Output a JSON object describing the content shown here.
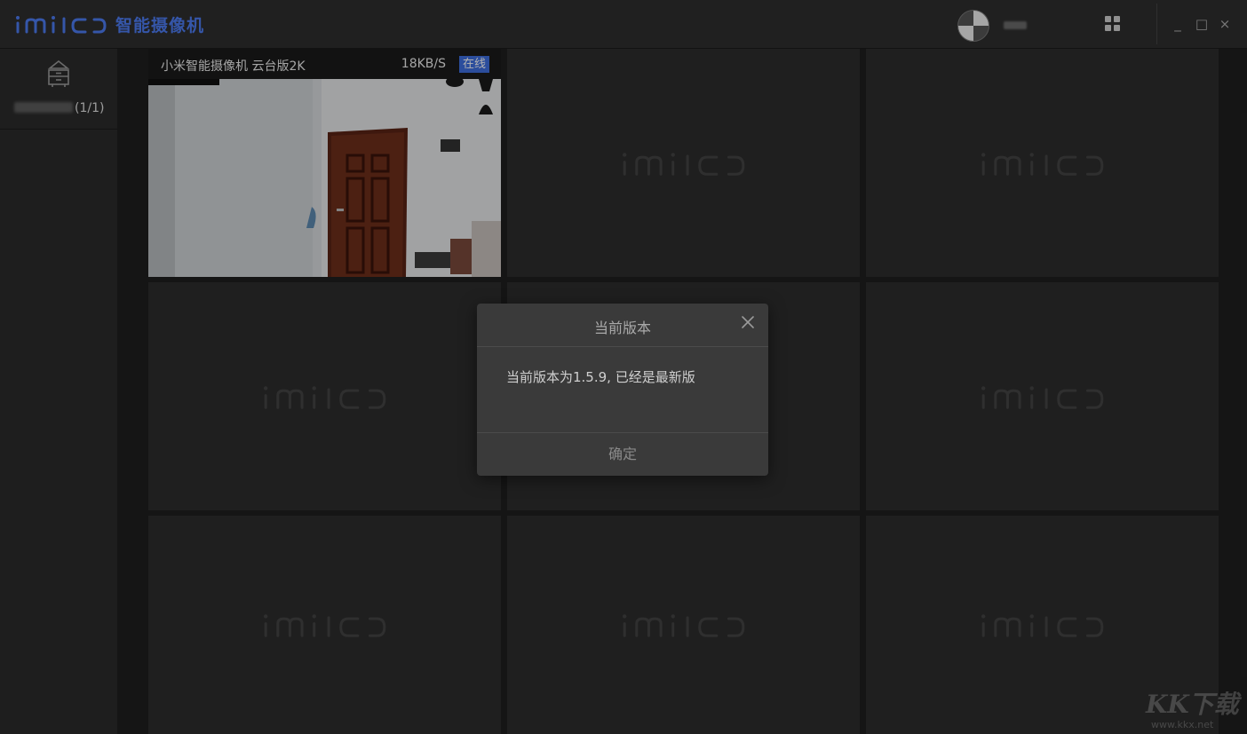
{
  "app": {
    "brand_text": "智能摄像机",
    "logo_icon": "imilab-logo",
    "accent_color": "#4d7bf3"
  },
  "titlebar": {
    "minimize_label": "_",
    "maximize_label": "□",
    "close_label": "×"
  },
  "sidebar": {
    "group_count": "(1/1)",
    "group_icon": "house-icon"
  },
  "camera": {
    "name": "小米智能摄像机 云台版2K",
    "rate": "18KB/S",
    "status": "在线",
    "status_color": "#3e6fe0"
  },
  "dialog": {
    "title": "当前版本",
    "message": "当前版本为1.5.9, 已经是最新版",
    "ok_label": "确定"
  },
  "watermark": {
    "text": "KK下载",
    "url": "www.kkx.net"
  }
}
